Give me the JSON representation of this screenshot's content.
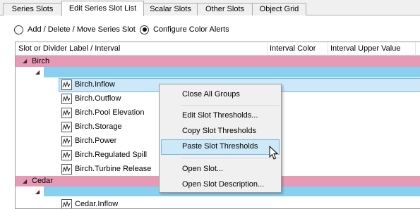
{
  "tabs": [
    {
      "label": "Series Slots",
      "active": false
    },
    {
      "label": "Edit Series Slot List",
      "active": true
    },
    {
      "label": "Scalar Slots",
      "active": false
    },
    {
      "label": "Other Slots",
      "active": false
    },
    {
      "label": "Object Grid",
      "active": false
    }
  ],
  "modes": {
    "add_delete_move": {
      "label": "Add / Delete / Move Series Slot",
      "checked": false
    },
    "configure_color_alerts": {
      "label": "Configure Color Alerts",
      "checked": true
    }
  },
  "table": {
    "columns": [
      "Slot or Divider Label / Interval",
      "Interval Color",
      "Interval Upper Value"
    ],
    "groups": [
      {
        "name": "Birch",
        "slots": [
          "Birch.Inflow",
          "Birch.Outflow",
          "Birch.Pool Elevation",
          "Birch.Storage",
          "Birch.Power",
          "Birch.Regulated Spill",
          "Birch.Turbine Release"
        ],
        "selected_slot": "Birch.Inflow"
      },
      {
        "name": "Cedar",
        "slots": [
          "Cedar.Inflow"
        ]
      }
    ]
  },
  "context_menu": {
    "items": [
      {
        "label": "Close All Groups"
      },
      {
        "label": "Edit Slot Thresholds..."
      },
      {
        "label": "Copy Slot Thresholds"
      },
      {
        "label": "Paste Slot Thresholds",
        "highlighted": true
      },
      {
        "label": "Open Slot..."
      },
      {
        "label": "Open Slot Description..."
      }
    ]
  },
  "colors": {
    "group_row": "#e79ab6",
    "interval_row": "#88d0f0",
    "selection": "#cde8f7",
    "selection_border": "#7ab9e3"
  }
}
